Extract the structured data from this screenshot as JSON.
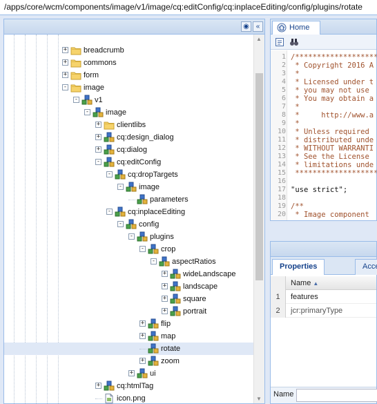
{
  "address_bar": {
    "path": "/apps/core/wcm/components/image/v1/image/cq:editConfig/cq:inplaceEditing/config/plugins/rotate"
  },
  "tree": {
    "rows": [
      {
        "label": "breadcrumb",
        "icon": "folder",
        "depth": 5,
        "expander": "+"
      },
      {
        "label": "commons",
        "icon": "folder",
        "depth": 5,
        "expander": "+"
      },
      {
        "label": "form",
        "icon": "folder",
        "depth": 5,
        "expander": "+"
      },
      {
        "label": "image",
        "icon": "folder",
        "depth": 5,
        "expander": "-"
      },
      {
        "label": "v1",
        "icon": "node",
        "depth": 6,
        "expander": "-"
      },
      {
        "label": "image",
        "icon": "node",
        "depth": 7,
        "expander": "-"
      },
      {
        "label": "clientlibs",
        "icon": "folder",
        "depth": 8,
        "expander": "+"
      },
      {
        "label": "cq:design_dialog",
        "icon": "node",
        "depth": 8,
        "expander": "+"
      },
      {
        "label": "cq:dialog",
        "icon": "node",
        "depth": 8,
        "expander": "+"
      },
      {
        "label": "cq:editConfig",
        "icon": "node",
        "depth": 8,
        "expander": "-"
      },
      {
        "label": "cq:dropTargets",
        "icon": "node",
        "depth": 9,
        "expander": "-"
      },
      {
        "label": "image",
        "icon": "node",
        "depth": 10,
        "expander": "-"
      },
      {
        "label": "parameters",
        "icon": "node",
        "depth": 11,
        "expander": ""
      },
      {
        "label": "cq:inplaceEditing",
        "icon": "node",
        "depth": 9,
        "expander": "-"
      },
      {
        "label": "config",
        "icon": "node",
        "depth": 10,
        "expander": "-"
      },
      {
        "label": "plugins",
        "icon": "node",
        "depth": 11,
        "expander": "-"
      },
      {
        "label": "crop",
        "icon": "node",
        "depth": 12,
        "expander": "-"
      },
      {
        "label": "aspectRatios",
        "icon": "node",
        "depth": 13,
        "expander": "-"
      },
      {
        "label": "wideLandscape",
        "icon": "node",
        "depth": 14,
        "expander": "+"
      },
      {
        "label": "landscape",
        "icon": "node",
        "depth": 14,
        "expander": "+"
      },
      {
        "label": "square",
        "icon": "node",
        "depth": 14,
        "expander": "+"
      },
      {
        "label": "portrait",
        "icon": "node",
        "depth": 14,
        "expander": "+"
      },
      {
        "label": "flip",
        "icon": "node",
        "depth": 12,
        "expander": "+"
      },
      {
        "label": "map",
        "icon": "node",
        "depth": 12,
        "expander": "+"
      },
      {
        "label": "rotate",
        "icon": "node",
        "depth": 12,
        "expander": "",
        "selected": true
      },
      {
        "label": "zoom",
        "icon": "node",
        "depth": 12,
        "expander": "+"
      },
      {
        "label": "ui",
        "icon": "node",
        "depth": 11,
        "expander": "+"
      },
      {
        "label": "cq:htmlTag",
        "icon": "node",
        "depth": 8,
        "expander": "+"
      },
      {
        "label": "icon.png",
        "icon": "file",
        "depth": 8,
        "expander": ""
      },
      {
        "label": "",
        "icon": "file",
        "depth": 8,
        "expander": ""
      }
    ]
  },
  "editor": {
    "tab_label": "Home",
    "lines": [
      {
        "n": "1",
        "text": "/******************************",
        "kind": "comment"
      },
      {
        "n": "2",
        "text": " * Copyright 2016 A",
        "kind": "comment"
      },
      {
        "n": "3",
        "text": " *",
        "kind": "comment"
      },
      {
        "n": "4",
        "text": " * Licensed under t",
        "kind": "comment"
      },
      {
        "n": "5",
        "text": " * you may not use ",
        "kind": "comment"
      },
      {
        "n": "6",
        "text": " * You may obtain a",
        "kind": "comment"
      },
      {
        "n": "7",
        "text": " *",
        "kind": "comment"
      },
      {
        "n": "8",
        "text": " *     http://www.a",
        "kind": "comment"
      },
      {
        "n": "9",
        "text": " *",
        "kind": "comment"
      },
      {
        "n": "10",
        "text": " * Unless required ",
        "kind": "comment"
      },
      {
        "n": "11",
        "text": " * distributed unde",
        "kind": "comment"
      },
      {
        "n": "12",
        "text": " * WITHOUT WARRANTI",
        "kind": "comment"
      },
      {
        "n": "13",
        "text": " * See the License ",
        "kind": "comment"
      },
      {
        "n": "14",
        "text": " * limitations unde",
        "kind": "comment"
      },
      {
        "n": "15",
        "text": " ******************************",
        "kind": "comment"
      },
      {
        "n": "16",
        "text": "",
        "kind": "code"
      },
      {
        "n": "17",
        "text": "\"use strict\";",
        "kind": "code"
      },
      {
        "n": "18",
        "text": "",
        "kind": "code"
      },
      {
        "n": "19",
        "text": "/**",
        "kind": "comment"
      },
      {
        "n": "20",
        "text": " * Image component ",
        "kind": "comment"
      }
    ]
  },
  "properties": {
    "tabs": [
      "Properties",
      "Acce"
    ],
    "column_name": "Name",
    "rows": [
      {
        "n": "1",
        "name": "features"
      },
      {
        "n": "2",
        "name": "jcr:primaryType"
      }
    ],
    "name_label": "Name",
    "name_value": ""
  },
  "colors": {
    "panel_border": "#99bbe8",
    "header_text": "#15428b",
    "selection": "#dfe8f6"
  }
}
